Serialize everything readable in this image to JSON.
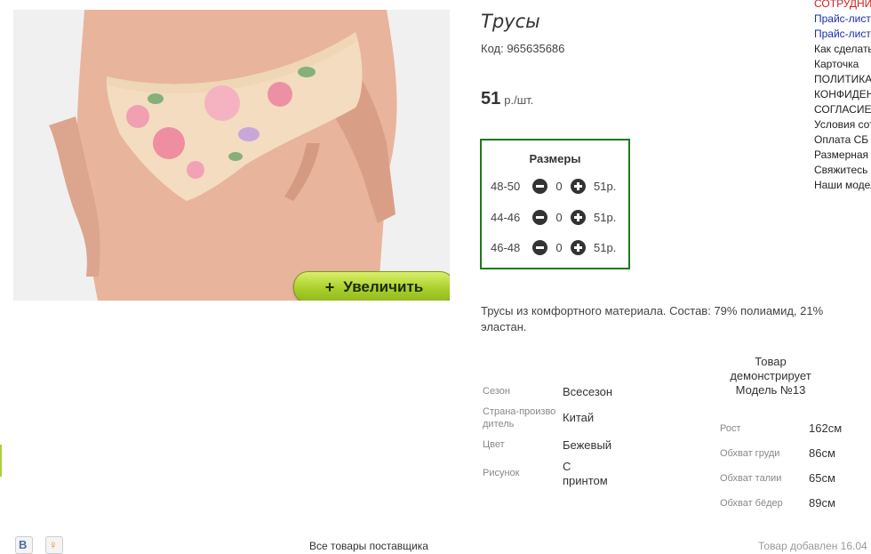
{
  "product": {
    "title": "Трусы",
    "code": "Код: 965635686",
    "price": "51",
    "price_unit": "р./шт.",
    "zoom_button": "Увеличить",
    "zoom_icon": "plus-icon"
  },
  "sizes": {
    "title": "Размеры",
    "rows": [
      {
        "size": "48-50",
        "qty": "0",
        "price": "51р."
      },
      {
        "size": "44-46",
        "qty": "0",
        "price": "51р."
      },
      {
        "size": "46-48",
        "qty": "0",
        "price": "51р."
      }
    ]
  },
  "description": "Трусы из комфортного материала. Состав: 79% полиамид, 21% эластан.",
  "attributes": [
    {
      "key": "Сезон",
      "value": "Всесезон"
    },
    {
      "key": "Страна-производитель",
      "value": "Китай"
    },
    {
      "key": "Цвет",
      "value": "Бежевый"
    },
    {
      "key": "Рисунок",
      "value": "С принтом"
    }
  ],
  "model": {
    "heading": "Товар демонстрирует Модель №13",
    "params": [
      {
        "key": "Рост",
        "value": "162см"
      },
      {
        "key": "Обхват груди",
        "value": "86см"
      },
      {
        "key": "Обхват талии",
        "value": "65см"
      },
      {
        "key": "Обхват бёдер",
        "value": "89см"
      }
    ]
  },
  "sidebar": {
    "items": [
      {
        "label": "СОТРУДНИЧЕСТВО",
        "style": "red"
      },
      {
        "label": "Прайс-лист",
        "style": "blue"
      },
      {
        "label": "Прайс-лист",
        "style": "blue"
      },
      {
        "label": "Как сделать заказ",
        "style": "plain"
      },
      {
        "label": "Карточка",
        "style": "plain"
      },
      {
        "label": "ПОЛИТИКА",
        "style": "plain"
      },
      {
        "label": "КОНФИДЕНЦИАЛЬНОСТИ",
        "style": "plain"
      },
      {
        "label": "СОГЛАСИЕ",
        "style": "plain"
      },
      {
        "label": "Условия сотрудничества",
        "style": "plain"
      },
      {
        "label": "Оплата СБ",
        "style": "plain"
      },
      {
        "label": "Размерная сетка",
        "style": "plain"
      },
      {
        "label": "Свяжитесь с нами",
        "style": "plain"
      },
      {
        "label": "Наши модели",
        "style": "plain"
      }
    ]
  },
  "footer": {
    "supplier_link": "Все товары поставщика",
    "added_date": "Товар добавлен 16.04"
  },
  "social": [
    {
      "icon": "vk-icon",
      "glyph": "В",
      "color": "#4a6fa0"
    },
    {
      "icon": "odnoklassniki-icon",
      "glyph": "♀",
      "color": "#ee8208"
    }
  ],
  "colors": {
    "sizes_border": "#1d7a1d",
    "zoom_button": "#a9cf2a",
    "accent_red": "#d21f1f",
    "link_blue": "#1a2fa8"
  }
}
